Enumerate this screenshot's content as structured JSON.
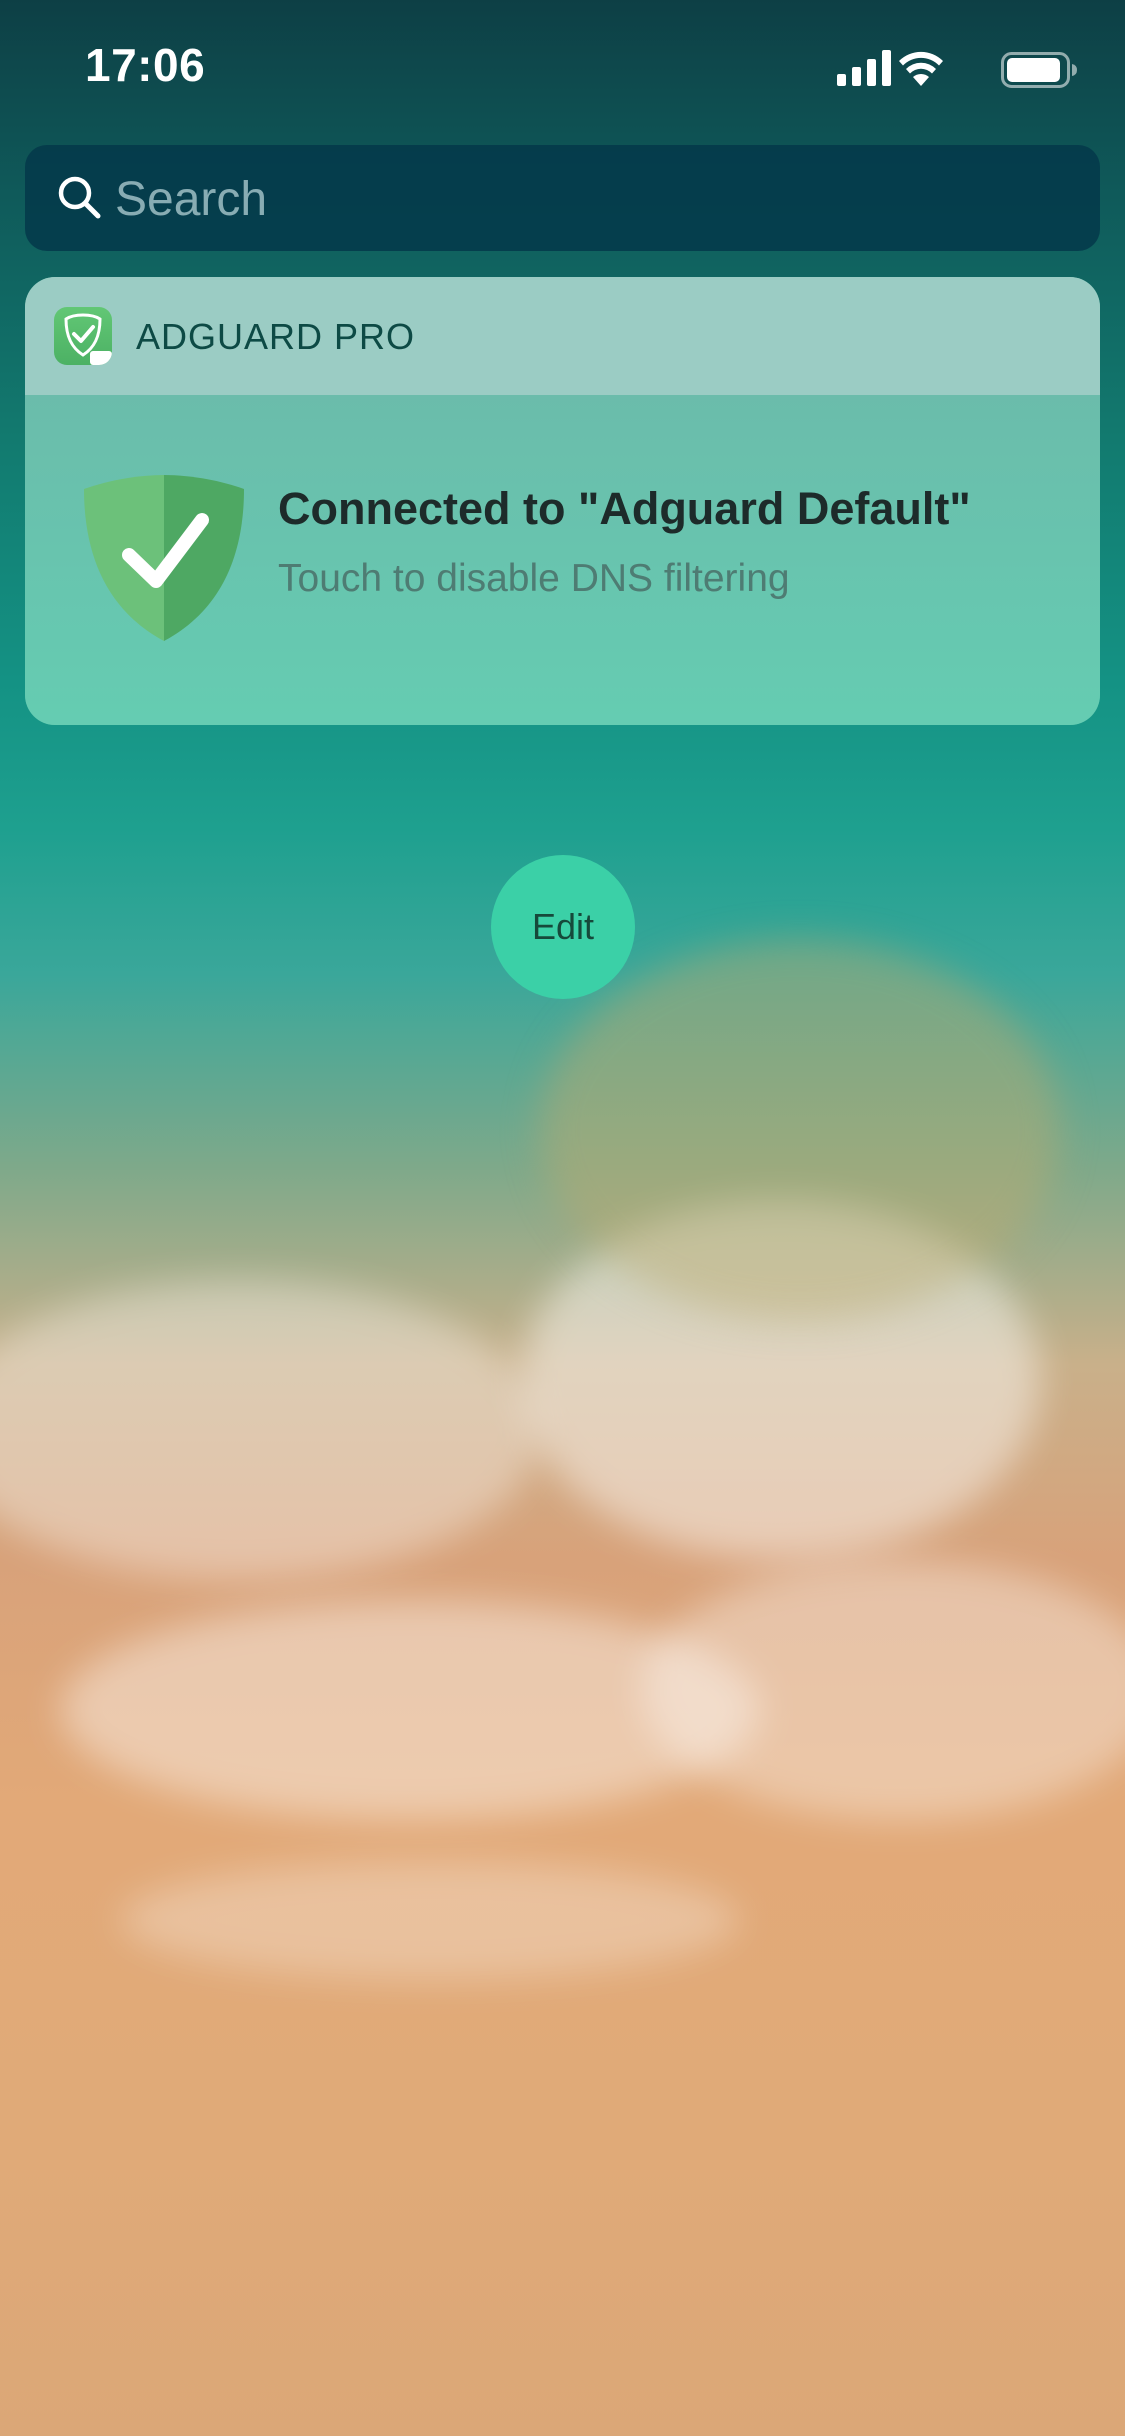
{
  "status_bar": {
    "time": "17:06"
  },
  "icons": {
    "signal": "cellular-signal-icon",
    "wifi": "wifi-icon",
    "battery": "battery-icon",
    "search": "search-icon",
    "app": "adguard-app-icon",
    "shield": "shield-check-icon"
  },
  "search": {
    "placeholder": "Search",
    "value": ""
  },
  "widget": {
    "app_name": "ADGUARD PRO",
    "app_badge": "PRO",
    "status_title": "Connected to \"Adguard Default\"",
    "status_subtitle": "Touch to disable DNS filtering"
  },
  "edit_button": {
    "label": "Edit"
  },
  "colors": {
    "shield_light": "#6cc17a",
    "shield_dark": "#4ea863",
    "edit_button": "#3bd0a7"
  }
}
